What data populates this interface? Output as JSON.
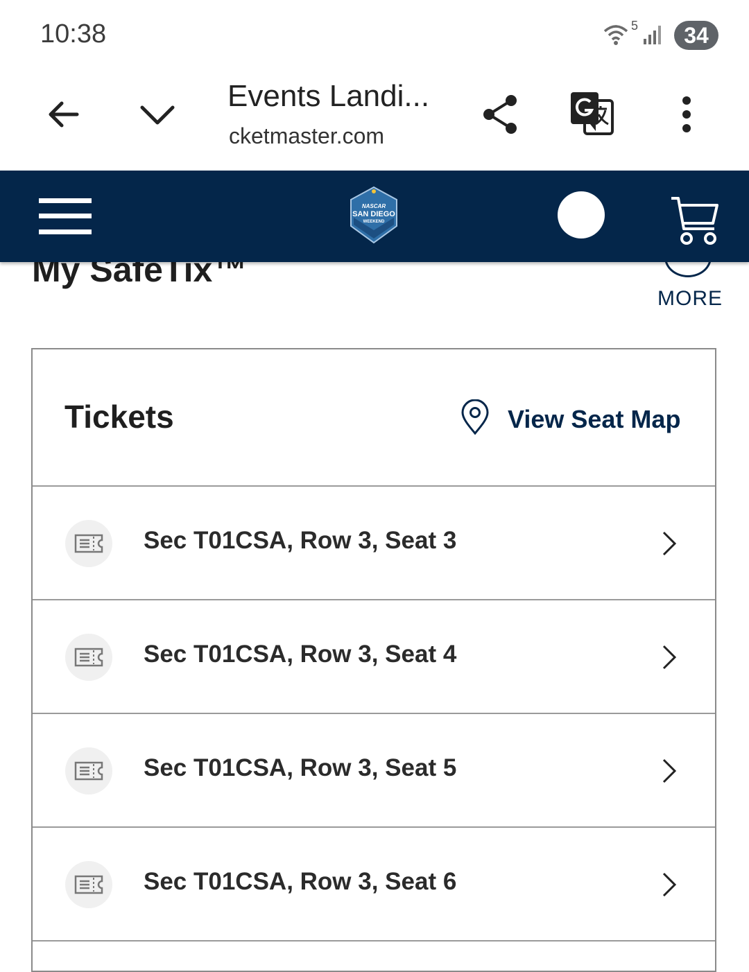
{
  "status_bar": {
    "time": "10:38",
    "wifi_badge": "5",
    "battery": "34"
  },
  "browser": {
    "title": "Events Landi...",
    "url": "cketmaster.com",
    "icons": [
      "back-arrow-icon",
      "chevron-down-icon",
      "share-icon",
      "translate-icon",
      "more-vert-icon"
    ]
  },
  "site_header": {
    "logo_lines": [
      "NASCAR",
      "SAN DIEGO",
      "WEEKEND"
    ],
    "icons": [
      "hamburger-menu-icon",
      "account-avatar",
      "cart-icon"
    ],
    "bg_color": "#04264a"
  },
  "page": {
    "title": "My SafeTix™",
    "more_label": "MORE",
    "tickets_heading": "Tickets",
    "seat_map_label": "View Seat Map",
    "accent_color": "#04264a"
  },
  "tickets": [
    {
      "label": "Sec T01CSA, Row 3, Seat 3"
    },
    {
      "label": "Sec T01CSA, Row 3, Seat 4"
    },
    {
      "label": "Sec T01CSA, Row 3, Seat 5"
    },
    {
      "label": "Sec T01CSA, Row 3, Seat 6"
    }
  ]
}
